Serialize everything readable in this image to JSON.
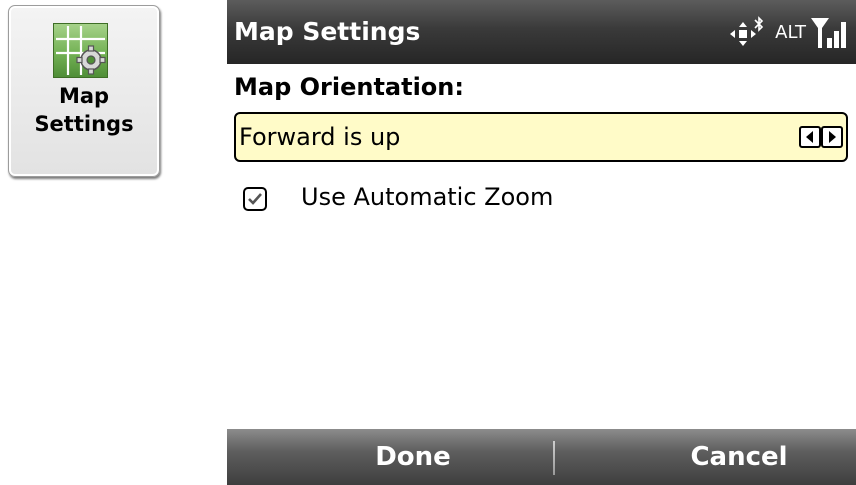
{
  "launcher": {
    "label_line1": "Map",
    "label_line2": "Settings",
    "icon": "map-settings-icon"
  },
  "window": {
    "title": "Map Settings",
    "status": {
      "alt_text": "ALT",
      "icons": [
        "data-connection-icon",
        "bluetooth-icon",
        "signal-strength-icon"
      ]
    }
  },
  "form": {
    "orientation_label": "Map Orientation:",
    "orientation_value": "Forward is up",
    "auto_zoom_label": "Use Automatic Zoom",
    "auto_zoom_checked": true
  },
  "softkeys": {
    "left": "Done",
    "right": "Cancel"
  },
  "colors": {
    "field_background": "#fffbc8",
    "titlebar": "#2e2e2e",
    "icon_green": "#74b255"
  }
}
